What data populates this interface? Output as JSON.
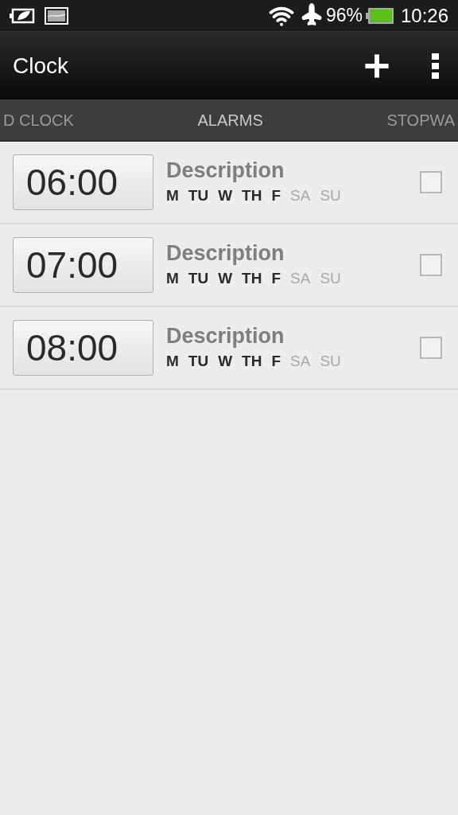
{
  "status_bar": {
    "battery": "96%",
    "time": "10:26"
  },
  "app_bar": {
    "title": "Clock"
  },
  "tabs": [
    {
      "label": "D CLOCK",
      "selected": false
    },
    {
      "label": "ALARMS",
      "selected": true
    },
    {
      "label": "STOPWA",
      "selected": false
    }
  ],
  "alarms": [
    {
      "time": "06:00",
      "description": "Description",
      "checked": false,
      "days": [
        {
          "label": "M",
          "on": true
        },
        {
          "label": "TU",
          "on": true
        },
        {
          "label": "W",
          "on": true
        },
        {
          "label": "TH",
          "on": true
        },
        {
          "label": "F",
          "on": true
        },
        {
          "label": "SA",
          "on": false
        },
        {
          "label": "SU",
          "on": false
        }
      ]
    },
    {
      "time": "07:00",
      "description": "Description",
      "checked": false,
      "days": [
        {
          "label": "M",
          "on": true
        },
        {
          "label": "TU",
          "on": true
        },
        {
          "label": "W",
          "on": true
        },
        {
          "label": "TH",
          "on": true
        },
        {
          "label": "F",
          "on": true
        },
        {
          "label": "SA",
          "on": false
        },
        {
          "label": "SU",
          "on": false
        }
      ]
    },
    {
      "time": "08:00",
      "description": "Description",
      "checked": false,
      "days": [
        {
          "label": "M",
          "on": true
        },
        {
          "label": "TU",
          "on": true
        },
        {
          "label": "W",
          "on": true
        },
        {
          "label": "TH",
          "on": true
        },
        {
          "label": "F",
          "on": true
        },
        {
          "label": "SA",
          "on": false
        },
        {
          "label": "SU",
          "on": false
        }
      ]
    }
  ]
}
